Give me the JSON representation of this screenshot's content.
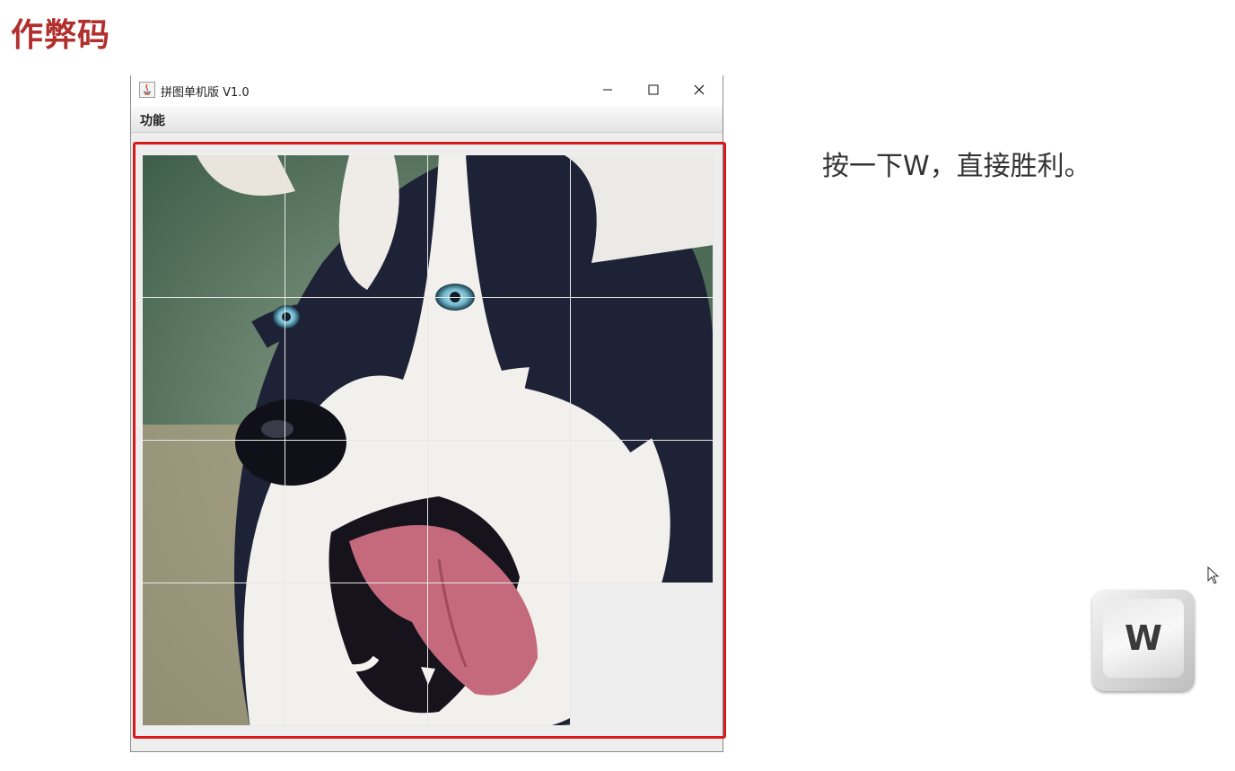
{
  "slide": {
    "title": "作弊码",
    "instruction": "按一下W，直接胜利。"
  },
  "window": {
    "title": "拼图单机版 V1.0",
    "app_icon": "java-icon",
    "controls": [
      "minimize-icon",
      "maximize-icon",
      "close-icon"
    ]
  },
  "menu": {
    "items": [
      "功能"
    ]
  },
  "puzzle": {
    "grid_rows": 4,
    "grid_cols": 4,
    "image_subject": "husky-dog-face",
    "empty_slot": {
      "row": 4,
      "col": 4
    }
  },
  "key_hint": {
    "label": "W",
    "icon": "keyboard-key-icon"
  },
  "colors": {
    "title_red": "#b1302e",
    "highlight_red": "#d81a1a",
    "window_bg": "#eeeeee"
  }
}
